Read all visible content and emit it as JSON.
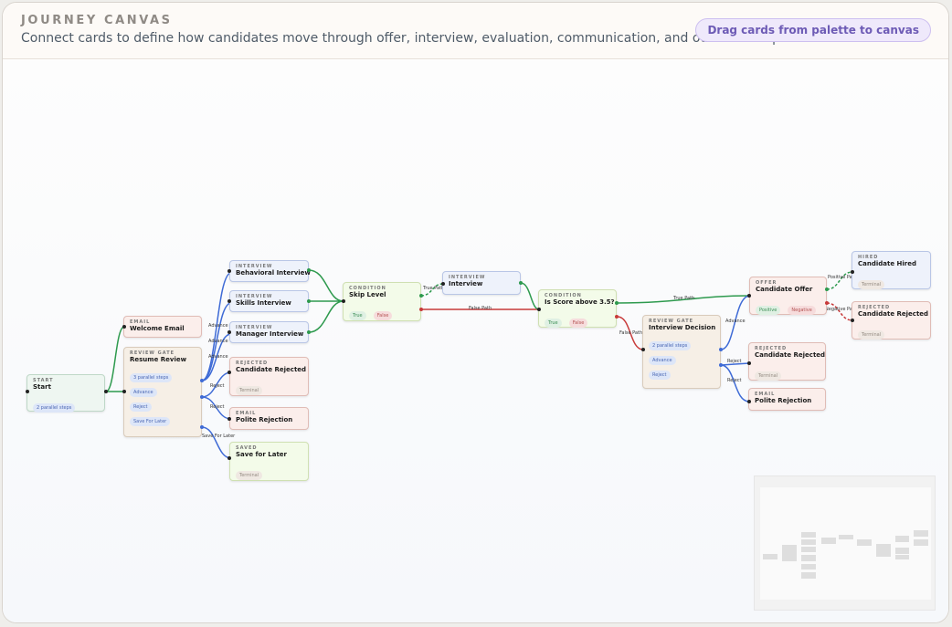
{
  "header": {
    "title": "JOURNEY CANVAS",
    "subtitle": "Connect cards to define how candidates move through offer, interview, evaluation, communication, and outcome steps.",
    "action_label": "Drag cards from palette to canvas"
  },
  "nodes": {
    "start": {
      "kind": "START",
      "title": "Start",
      "chips": [
        "2 parallel steps"
      ]
    },
    "welcome_email": {
      "kind": "EMAIL",
      "title": "Welcome Email"
    },
    "resume_review": {
      "kind": "REVIEW GATE",
      "title": "Resume Review",
      "chips": [
        "3 parallel steps",
        "Advance",
        "Reject",
        "Save For Later"
      ]
    },
    "behavioral_interview": {
      "kind": "INTERVIEW",
      "title": "Behavioral Interview"
    },
    "skills_interview": {
      "kind": "INTERVIEW",
      "title": "Skills Interview"
    },
    "manager_interview": {
      "kind": "INTERVIEW",
      "title": "Manager Interview"
    },
    "candidate_rejected_1": {
      "kind": "REJECTED",
      "title": "Candidate Rejected",
      "chips": [
        "Terminal"
      ]
    },
    "polite_rejection_1": {
      "kind": "EMAIL",
      "title": "Polite Rejection"
    },
    "save_for_later": {
      "kind": "SAVED",
      "title": "Save for Later",
      "chips": [
        "Terminal"
      ]
    },
    "skip_level": {
      "kind": "CONDITION",
      "title": "Skip Level",
      "chips": [
        "True",
        "False"
      ]
    },
    "interview": {
      "kind": "INTERVIEW",
      "title": "Interview"
    },
    "score_condition": {
      "kind": "CONDITION",
      "title": "Is Score above 3.5?",
      "chips": [
        "True",
        "False"
      ]
    },
    "interview_decision": {
      "kind": "REVIEW GATE",
      "title": "Interview Decision",
      "chips": [
        "2 parallel steps",
        "Advance",
        "Reject"
      ]
    },
    "candidate_offer": {
      "kind": "OFFER",
      "title": "Candidate Offer",
      "chips": [
        "Positive",
        "Negative"
      ]
    },
    "candidate_rejected_2": {
      "kind": "REJECTED",
      "title": "Candidate Rejected",
      "chips": [
        "Terminal"
      ]
    },
    "polite_rejection_2": {
      "kind": "EMAIL",
      "title": "Polite Rejection"
    },
    "candidate_hired": {
      "kind": "HIRED",
      "title": "Candidate Hired",
      "chips": [
        "Terminal"
      ]
    },
    "candidate_rejected_3": {
      "kind": "REJECTED",
      "title": "Candidate Rejected",
      "chips": [
        "Terminal"
      ]
    }
  },
  "edge_labels": {
    "advance_1": "Advance",
    "advance_2": "Advance",
    "advance_3": "Advance",
    "reject_1": "Reject",
    "reject_2": "Reject",
    "save_for_later": "Save For Later",
    "true_path_1": "True Path",
    "false_path_1": "False Path",
    "true_path_2": "True Path",
    "false_path_2": "False Path",
    "advance_4": "Advance",
    "reject_3": "Reject",
    "reject_4": "Reject",
    "positive_path": "Positive Path",
    "negative_path": "Negative Path"
  },
  "colors": {
    "edge_green": "#2e9a4e",
    "edge_blue": "#3f6bd6",
    "edge_red": "#c83a3a",
    "edge_black": "#222222"
  }
}
